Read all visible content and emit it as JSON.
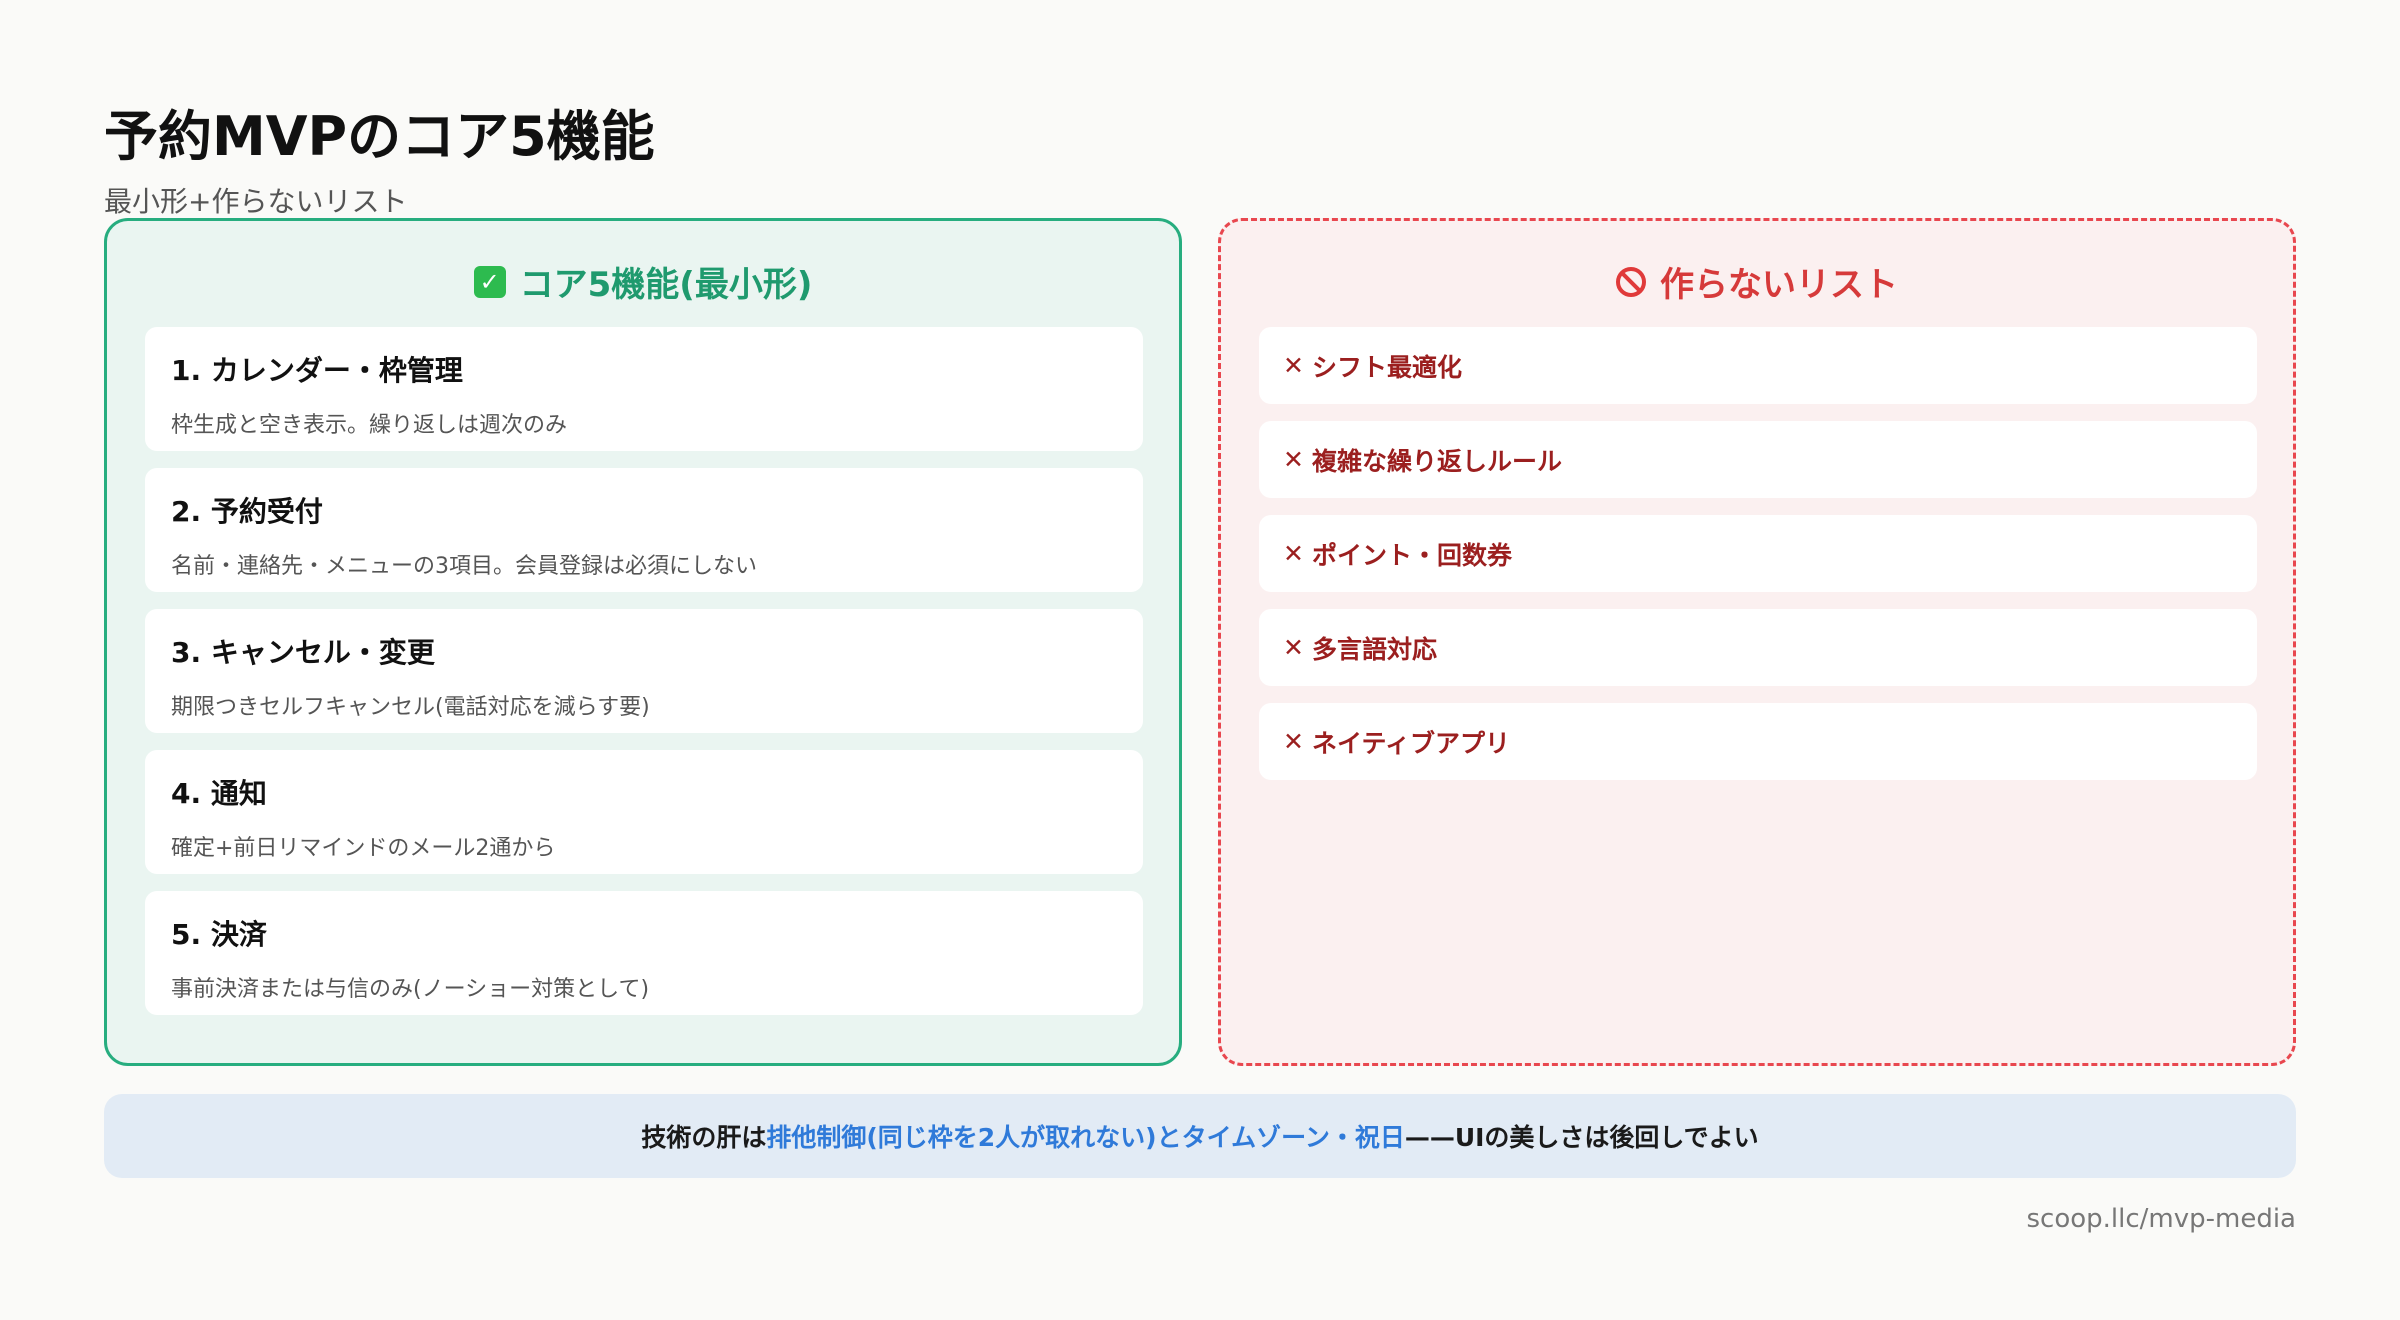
{
  "header": {
    "title": "予約MVPのコア5機能",
    "subtitle": "最小形+作らないリスト"
  },
  "core_panel": {
    "icon": "check-icon",
    "heading": "コア5機能(最小形)",
    "items": [
      {
        "name": "1. カレンダー・枠管理",
        "desc": "枠生成と空き表示。繰り返しは週次のみ"
      },
      {
        "name": "2. 予約受付",
        "desc": "名前・連絡先・メニューの3項目。会員登録は必須にしない"
      },
      {
        "name": "3. キャンセル・変更",
        "desc": "期限つきセルフキャンセル(電話対応を減らす要)"
      },
      {
        "name": "4. 通知",
        "desc": "確定+前日リマインドのメール2通から"
      },
      {
        "name": "5. 決済",
        "desc": "事前決済または与信のみ(ノーショー対策として)"
      }
    ]
  },
  "nope_panel": {
    "icon": "no-entry-icon",
    "heading": "作らないリスト",
    "mark": "✕",
    "items": [
      "シフト最適化",
      "複雑な繰り返しルール",
      "ポイント・回数券",
      "多言語対応",
      "ネイティブアプリ"
    ]
  },
  "callout": {
    "lead": "技術の肝は ",
    "highlight": "排他制御(同じ枠を2人が取れない)とタイムゾーン・祝日",
    "tail": "——UIの美しさは後回しでよい"
  },
  "footer": {
    "source": "scoop.llc/mvp-media"
  },
  "colors": {
    "accent_green": "#27ad7f",
    "accent_red": "#e8474f",
    "highlight_blue": "#2f7ad9"
  }
}
